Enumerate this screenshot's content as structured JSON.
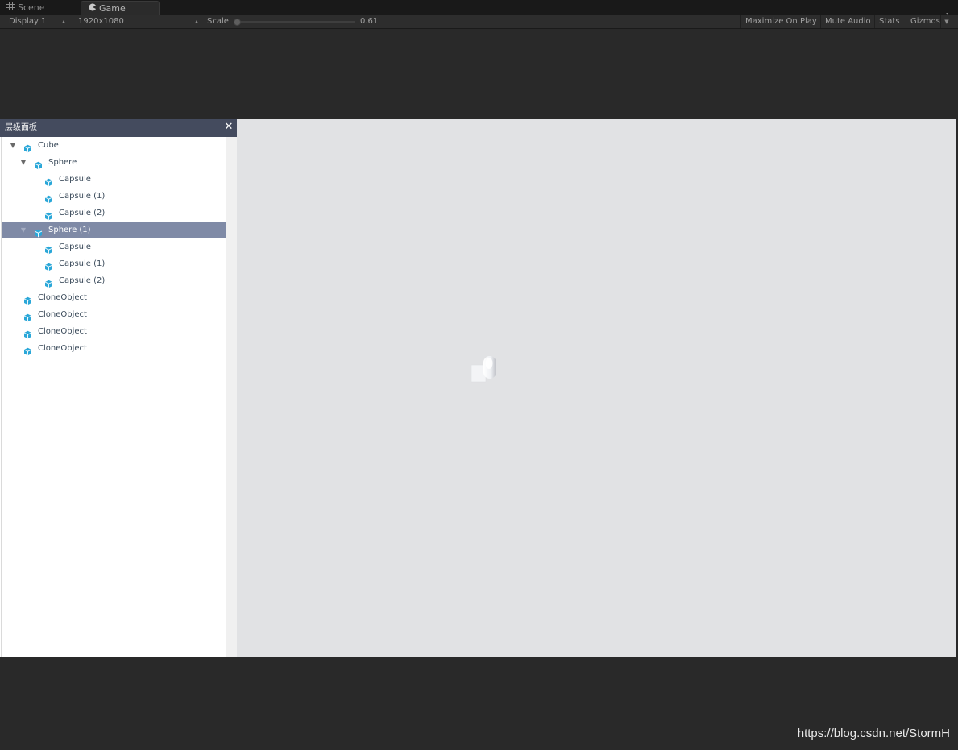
{
  "tabs": {
    "scene": "Scene",
    "game": "Game"
  },
  "toolbar": {
    "display": "Display 1",
    "resolution": "1920x1080",
    "scale_label": "Scale",
    "scale_value": "0.61",
    "scale_fraction": 0.0,
    "maximize_on_play": "Maximize On Play",
    "mute_audio": "Mute Audio",
    "stats": "Stats",
    "gizmos": "Gizmos"
  },
  "hierarchy": {
    "title": "层级面板",
    "close_icon": "close-icon",
    "items": [
      {
        "label": "Cube",
        "depth": 0,
        "expanded": true,
        "selected": false
      },
      {
        "label": "Sphere",
        "depth": 1,
        "expanded": true,
        "selected": false
      },
      {
        "label": "Capsule",
        "depth": 2,
        "expanded": null,
        "selected": false
      },
      {
        "label": "Capsule (1)",
        "depth": 2,
        "expanded": null,
        "selected": false
      },
      {
        "label": "Capsule (2)",
        "depth": 2,
        "expanded": null,
        "selected": false
      },
      {
        "label": "Sphere (1)",
        "depth": 1,
        "expanded": true,
        "selected": true
      },
      {
        "label": "Capsule",
        "depth": 2,
        "expanded": null,
        "selected": false
      },
      {
        "label": "Capsule (1)",
        "depth": 2,
        "expanded": null,
        "selected": false
      },
      {
        "label": "Capsule (2)",
        "depth": 2,
        "expanded": null,
        "selected": false
      },
      {
        "label": "CloneObject",
        "depth": 0,
        "expanded": null,
        "selected": false
      },
      {
        "label": "CloneObject",
        "depth": 0,
        "expanded": null,
        "selected": false
      },
      {
        "label": "CloneObject",
        "depth": 0,
        "expanded": null,
        "selected": false
      },
      {
        "label": "CloneObject",
        "depth": 0,
        "expanded": null,
        "selected": false
      }
    ]
  },
  "colors": {
    "editor_background": "#292929",
    "game_background": "#e1e2e4",
    "panel_header": "#444b5e",
    "selection": "#7f8aa6",
    "object_icon": "#2aa7d8"
  },
  "watermark": "https://blog.csdn.net/StormH"
}
